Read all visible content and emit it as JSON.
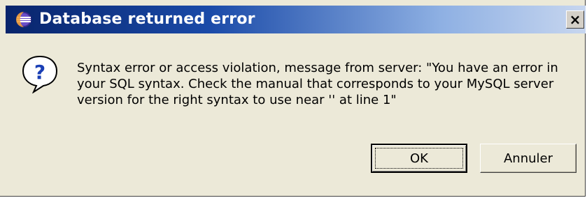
{
  "window": {
    "title": "Database returned error",
    "close_label": "×"
  },
  "icons": {
    "app": "eclipse-icon",
    "message": "question-icon",
    "close": "close-icon"
  },
  "message": {
    "lines": [
      "Syntax error or access violation,  message from server: \"You have an error in",
      "your SQL syntax.  Check the manual that corresponds to your MySQL server",
      "version for the right syntax to use near '' at line 1\""
    ]
  },
  "buttons": {
    "ok_label": "OK",
    "cancel_label": "Annuler"
  },
  "colors": {
    "title_bar_start": "#08246b",
    "title_bar_end": "#c7d6ef",
    "dialog_bg": "#ece9d8"
  }
}
